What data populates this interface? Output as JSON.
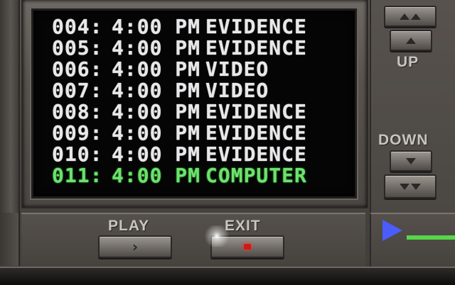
{
  "log": {
    "entries": [
      {
        "id": "004:",
        "time": "4:00 PM",
        "type": "EVIDENCE",
        "active": false
      },
      {
        "id": "005:",
        "time": "4:00 PM",
        "type": "EVIDENCE",
        "active": false
      },
      {
        "id": "006:",
        "time": "4:00 PM",
        "type": "VIDEO",
        "active": false
      },
      {
        "id": "007:",
        "time": "4:00 PM",
        "type": "VIDEO",
        "active": false
      },
      {
        "id": "008:",
        "time": "4:00 PM",
        "type": "EVIDENCE",
        "active": false
      },
      {
        "id": "009:",
        "time": "4:00 PM",
        "type": "EVIDENCE",
        "active": false
      },
      {
        "id": "010:",
        "time": "4:00 PM",
        "type": "EVIDENCE",
        "active": false
      },
      {
        "id": "011:",
        "time": "4:00 PM",
        "type": "COMPUTER",
        "active": true
      }
    ]
  },
  "controls": {
    "up_label": "UP",
    "down_label": "DOWN",
    "play_label": "PLAY",
    "exit_label": "EXIT"
  },
  "colors": {
    "active_text": "#6fe06f",
    "normal_text": "#e8e8ea",
    "play_indicator": "#4b5cff",
    "progress": "#57d64a",
    "exit_led": "#d21a12"
  },
  "icons": {
    "page_up": "double-up-arrow-icon",
    "line_up": "up-arrow-icon",
    "line_down": "down-arrow-icon",
    "page_down": "double-down-arrow-icon",
    "play": "chevron-right-icon",
    "exit": "red-led-icon",
    "status": "play-triangle-icon"
  }
}
